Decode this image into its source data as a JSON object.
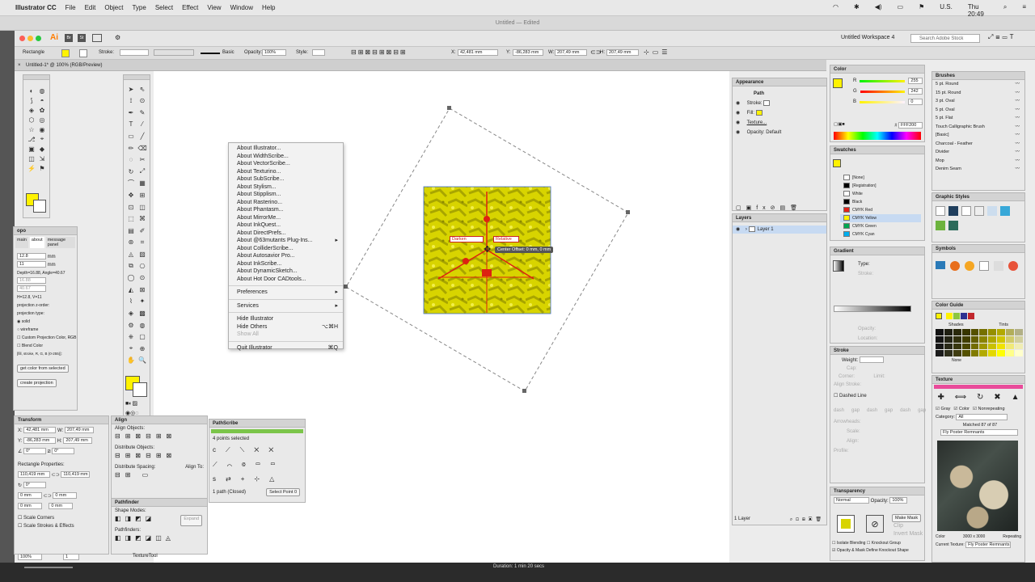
{
  "menubar": {
    "apple": "",
    "items": [
      "Illustrator CC",
      "File",
      "Edit",
      "Object",
      "Type",
      "Select",
      "Effect",
      "View",
      "Window",
      "Help"
    ],
    "clock": "Thu 20:49",
    "locale": "U.S."
  },
  "window": {
    "title": "Untitled — Edited"
  },
  "appbar": {
    "logo": "Ai",
    "workspace": "Untitled Workspace 4",
    "search_placeholder": "Search Adobe Stock"
  },
  "control": {
    "object_type": "Rectangle",
    "stroke_label": "Stroke:",
    "stroke_style": "Basic",
    "opacity_label": "Opacity:",
    "opacity": "100%",
    "style_label": "Style:",
    "x_label": "X:",
    "x": "42,481 mm",
    "y_label": "Y:",
    "y": "-86,283 mm",
    "w_label": "W:",
    "w": "207,49 mm",
    "h_label": "H:",
    "h": "207,49 mm"
  },
  "doc_tab": {
    "title": "Untitled-1* @ 100% (RGB/Preview)"
  },
  "context_menu": {
    "group1": [
      "About Illustrator...",
      "About WidthScribe...",
      "About VectorScribe...",
      "About Texturino...",
      "About SubScribe...",
      "About Stylism...",
      "About Stipplism...",
      "About Rasterino...",
      "About Phantasm...",
      "About MirrorMe...",
      "About InkQuest...",
      "About DirectPrefs...",
      "About @63mutants Plug-Ins...",
      "About ColliderScribe...",
      "About Autosavior Pro...",
      "About InkScribe...",
      "About DynamicSketch...",
      "About Hot Door CADtools..."
    ],
    "preferences": "Preferences",
    "services": "Services",
    "hide": "Hide Illustrator",
    "hide_others": "Hide Others",
    "hide_others_shortcut": "⌥⌘H",
    "show_all": "Show All",
    "quit": "Quit Illustrator",
    "quit_shortcut": "⌘Q"
  },
  "canvas": {
    "blend_mode": "Darken",
    "relative": "Relative",
    "tooltip": "Center Offset: 0 mm, 0 mm"
  },
  "opo_panel": {
    "title": "opo",
    "tabs": [
      "main",
      "about",
      "message panel"
    ],
    "field1": "12.8",
    "unit1": "mm",
    "field2": "11",
    "unit2": "mm",
    "depth": "Depth=16.88, Angle=40.67",
    "field3": "16.88",
    "field4": "40.67",
    "hv": "H=12.8, V=11",
    "proj_z": "projection z-order:",
    "proj_type": "projection type:",
    "solid": "solid",
    "wireframe": "wireframe",
    "custom": "Custom Projection Color, RGB",
    "blend": "Blend Color",
    "fill_label": "[fill, stroke, R, G, B (0-255)]:",
    "get_color": "get color from selected",
    "create": "create projection"
  },
  "transform": {
    "title": "Transform",
    "x": "42,481 mm",
    "y": "-86,283 mm",
    "w": "207,49 mm",
    "h": "207,49 mm",
    "angle": "0°",
    "shear": "0°",
    "rect_props": "Rectangle Properties:",
    "rw": "110,419 mm",
    "rh": "110,419 mm",
    "rot": "0°",
    "r1": "0 mm",
    "r2": "0 mm",
    "r3": "0 mm",
    "r4": "0 mm",
    "scale_corners": "Scale Corners",
    "scale_strokes": "Scale Strokes & Effects"
  },
  "align": {
    "title": "Align",
    "align_objects": "Align Objects:",
    "distribute_objects": "Distribute Objects:",
    "distribute_spacing": "Distribute Spacing:",
    "align_to": "Align To:"
  },
  "pathfinder": {
    "title": "Pathfinder",
    "shape_modes": "Shape Modes:",
    "expand": "Expand",
    "pathfinders": "Pathfinders:"
  },
  "pathscribe": {
    "title": "PathScribe",
    "selected": "4 points selected",
    "closed": "1 path (Closed)",
    "select_point": "Select Point 0"
  },
  "appearance": {
    "title": "Appearance",
    "path": "Path",
    "stroke": "Stroke:",
    "fill": "Fill:",
    "texture": "Texture...",
    "opacity": "Opacity: Default"
  },
  "layers": {
    "title": "Layers",
    "layer1": "Layer 1",
    "count": "1 Layer"
  },
  "color": {
    "title": "Color",
    "r": "255",
    "g": "242",
    "b": "0",
    "hex": "FFF200"
  },
  "swatches": {
    "title": "Swatches",
    "items": [
      "[None]",
      "[Registration]",
      "White",
      "Black",
      "CMYK Red",
      "CMYK Yellow",
      "CMYK Green",
      "CMYK Cyan"
    ],
    "colors": [
      "#ffffff",
      "#000000",
      "#ffffff",
      "#000000",
      "#e2231a",
      "#fff200",
      "#00a651",
      "#00aeef"
    ]
  },
  "gradient": {
    "title": "Gradient",
    "type": "Type:",
    "stroke": "Stroke:",
    "opacity": "Opacity:",
    "location": "Location:"
  },
  "stroke_panel": {
    "title": "Stroke",
    "weight": "Weight:",
    "cap": "Cap:",
    "corner": "Corner:",
    "limit": "Limit:",
    "align": "Align Stroke:",
    "dashed": "Dashed Line",
    "dash_labels": [
      "dash",
      "gap",
      "dash",
      "gap",
      "dash",
      "gap"
    ],
    "arrowheads": "Arrowheads:",
    "scale": "Scale:",
    "align2": "Align:",
    "profile": "Profile:"
  },
  "transparency": {
    "title": "Transparency",
    "mode": "Normal",
    "opacity_label": "Opacity:",
    "opacity": "100%",
    "make_mask": "Make Mask",
    "clip": "Clip",
    "invert": "Invert Mask",
    "isolate": "Isolate Blending",
    "knockout": "Knockout Group",
    "opacity_mask": "Opacity & Mask Define Knockout Shape"
  },
  "brushes": {
    "title": "Brushes",
    "items": [
      "5 pt. Round",
      "15 pt. Round",
      "3 pt. Oval",
      "5 pt. Oval",
      "5 pt. Flat",
      "Touch Calligraphic Brush",
      "[Basic]",
      "Charcoal - Feather",
      "Divider",
      "Mop",
      "Denim Seam"
    ]
  },
  "graphic_styles": {
    "title": "Graphic Styles"
  },
  "symbols": {
    "title": "Symbols"
  },
  "color_guide": {
    "title": "Color Guide",
    "shades": "Shades",
    "tints": "Tints",
    "none": "None"
  },
  "texture": {
    "title": "Texture",
    "gray": "Gray",
    "color": "Color",
    "nonrepeating": "Nonrepeating",
    "category_label": "Category:",
    "category": "All",
    "matched": "Matched 87 of 87",
    "selected": "Fly Poster Remnants",
    "info_color": "Color",
    "info_size": "3000 x 3000",
    "info_repeat": "Repeating",
    "current_label": "Current Texture:",
    "current": "Fly Poster Remnants"
  },
  "status": {
    "zoom": "100%",
    "artboard": "1",
    "tool": "TextureTool",
    "duration": "Duration: 1 min 20 secs"
  }
}
